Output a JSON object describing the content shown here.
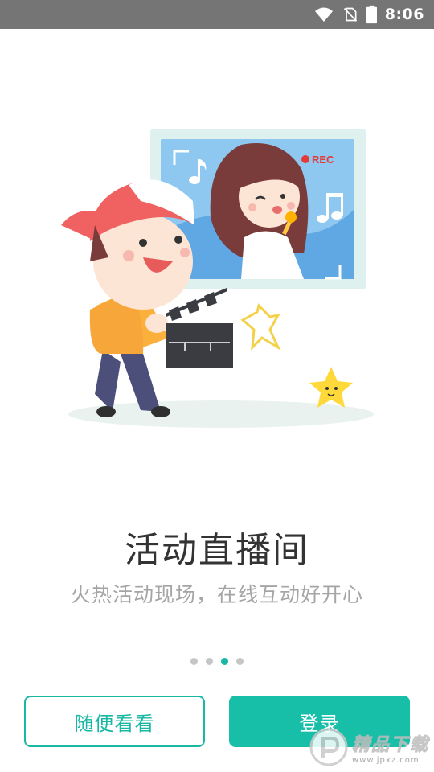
{
  "status_bar": {
    "time": "8:06",
    "icons": [
      "wifi-icon",
      "no-sim-icon",
      "battery-icon"
    ]
  },
  "illustration": {
    "rec_label": "REC"
  },
  "onboarding": {
    "title": "活动直播间",
    "subtitle": "火热活动现场，在线互动好开心",
    "pager": {
      "total": 4,
      "active_index": 2
    }
  },
  "actions": {
    "browse_label": "随便看看",
    "login_label": "登录"
  },
  "watermark": {
    "text": "精品下载",
    "url": "www.jpxz.com"
  },
  "colors": {
    "accent": "#17bea8",
    "status_bar": "#757575",
    "title": "#333333",
    "subtitle": "#a5a5a5",
    "dot_inactive": "#c6c6c6"
  }
}
